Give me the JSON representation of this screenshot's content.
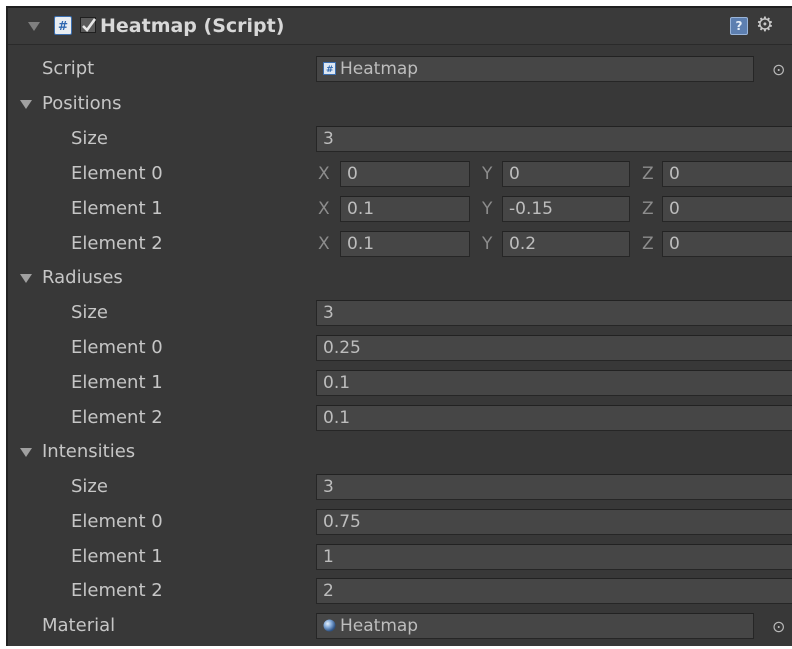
{
  "component": {
    "title": "Heatmap (Script)",
    "enabled": true
  },
  "script_field": {
    "label": "Script",
    "value": "Heatmap"
  },
  "positions": {
    "label": "Positions",
    "size_label": "Size",
    "size": "3",
    "elements": [
      {
        "label": "Element 0",
        "x": "0",
        "y": "0",
        "z": "0"
      },
      {
        "label": "Element 1",
        "x": "0.1",
        "y": "-0.15",
        "z": "0"
      },
      {
        "label": "Element 2",
        "x": "0.1",
        "y": "0.2",
        "z": "0"
      }
    ],
    "axis_labels": {
      "x": "X",
      "y": "Y",
      "z": "Z"
    }
  },
  "radiuses": {
    "label": "Radiuses",
    "size_label": "Size",
    "size": "3",
    "elements": [
      {
        "label": "Element 0",
        "value": "0.25"
      },
      {
        "label": "Element 1",
        "value": "0.1"
      },
      {
        "label": "Element 2",
        "value": "0.1"
      }
    ]
  },
  "intensities": {
    "label": "Intensities",
    "size_label": "Size",
    "size": "3",
    "elements": [
      {
        "label": "Element 0",
        "value": "0.75"
      },
      {
        "label": "Element 1",
        "value": "1"
      },
      {
        "label": "Element 2",
        "value": "2"
      }
    ]
  },
  "material_field": {
    "label": "Material",
    "value": "Heatmap"
  },
  "icons": {
    "foldout": "triangle-down-icon",
    "script": "csharp-script-icon",
    "help": "help-book-icon",
    "settings": "gear-icon",
    "object_picker": "target-icon",
    "material": "sphere-icon"
  },
  "colors": {
    "panel_bg": "#383838",
    "field_bg": "#464646",
    "label_text": "#c6c6c6",
    "title_text": "#d8d8d8",
    "help_icon": "#5d7fb0"
  }
}
